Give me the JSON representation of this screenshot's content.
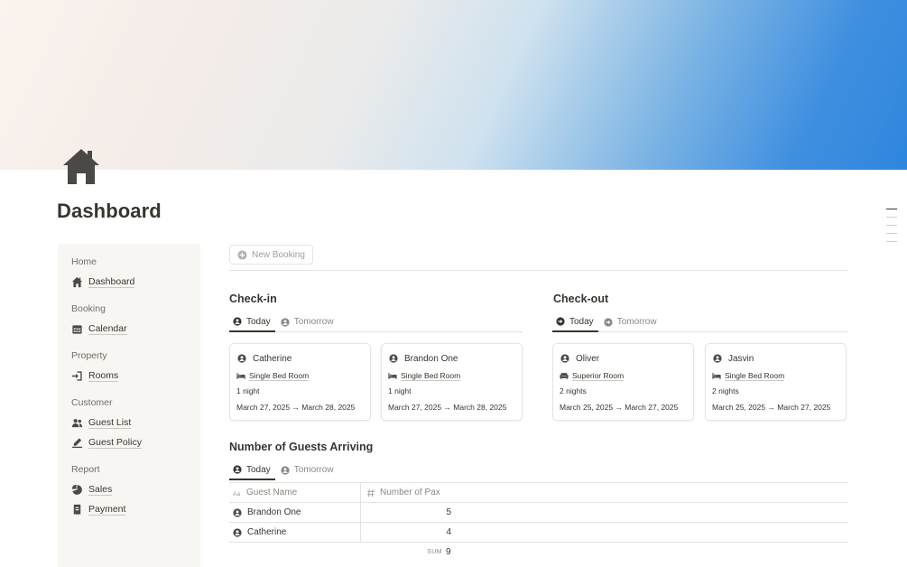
{
  "page": {
    "title": "Dashboard",
    "icon": "house-icon"
  },
  "sidebar": {
    "sections": [
      {
        "heading": "Home",
        "items": [
          {
            "label": "Dashboard",
            "icon": "house-icon"
          }
        ]
      },
      {
        "heading": "Booking",
        "items": [
          {
            "label": "Calendar",
            "icon": "calendar-icon"
          }
        ]
      },
      {
        "heading": "Property",
        "items": [
          {
            "label": "Rooms",
            "icon": "door-enter-icon"
          }
        ]
      },
      {
        "heading": "Customer",
        "items": [
          {
            "label": "Guest List",
            "icon": "people-icon"
          },
          {
            "label": "Guest Policy",
            "icon": "signature-icon"
          }
        ]
      },
      {
        "heading": "Report",
        "items": [
          {
            "label": "Sales",
            "icon": "pie-chart-icon"
          },
          {
            "label": "Payment",
            "icon": "receipt-icon"
          }
        ]
      }
    ]
  },
  "toolbar": {
    "new_booking_label": "New Booking"
  },
  "checkin": {
    "title": "Check-in",
    "tabs": [
      "Today",
      "Tomorrow"
    ],
    "cards": [
      {
        "name": "Catherine",
        "room": "Single Bed Room",
        "nights": "1 night",
        "dates": "March 27, 2025 → March 28, 2025"
      },
      {
        "name": "Brandon One",
        "room": "Single Bed Room",
        "nights": "1 night",
        "dates": "March 27, 2025 → March 28, 2025"
      }
    ]
  },
  "checkout": {
    "title": "Check-out",
    "tabs": [
      "Today",
      "Tomorrow"
    ],
    "cards": [
      {
        "name": "Oliver",
        "room": "Superior Room",
        "nights": "2 nights",
        "dates": "March 25, 2025 → March 27, 2025"
      },
      {
        "name": "Jasvin",
        "room": "Single Bed Room",
        "nights": "2 nights",
        "dates": "March 25, 2025 → March 27, 2025"
      }
    ]
  },
  "guests": {
    "title": "Number of Guests Arriving",
    "tabs": [
      "Today",
      "Tomorrow"
    ],
    "columns": [
      "Guest Name",
      "Number of Pax"
    ],
    "rows": [
      {
        "name": "Brandon One",
        "pax": "5"
      },
      {
        "name": "Catherine",
        "pax": "4"
      }
    ],
    "sum_label": "SUM",
    "sum_value": "9"
  },
  "colors": {
    "text": "#37352f",
    "muted": "#8a8883",
    "sidebar_bg": "#f7f6f3",
    "accent_blue": "#2f86de"
  }
}
